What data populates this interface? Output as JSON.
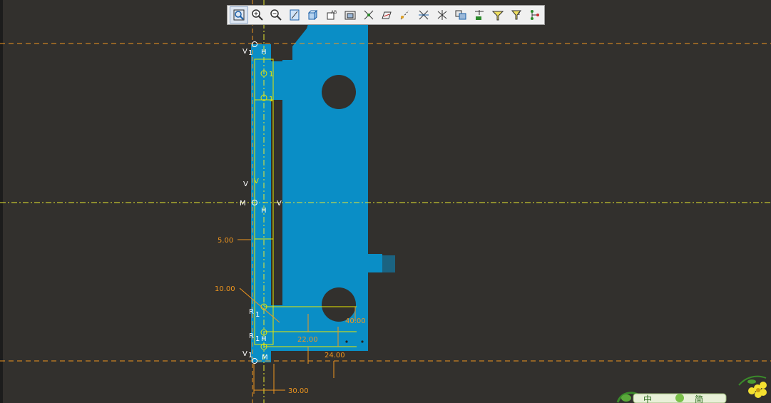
{
  "toolbar": {
    "buttons": [
      {
        "name": "fit-all-icon"
      },
      {
        "name": "zoom-in-icon"
      },
      {
        "name": "zoom-out-icon"
      },
      {
        "name": "normal-view-icon"
      },
      {
        "name": "view-mode-icon"
      },
      {
        "name": "render-style-icon"
      },
      {
        "name": "cut-part-icon"
      },
      {
        "name": "sketch-solving-status-icon"
      },
      {
        "name": "sketch-analysis-icon"
      },
      {
        "name": "construction-element-icon"
      },
      {
        "name": "geometric-constraints-icon"
      },
      {
        "name": "dimensional-constraints-icon"
      },
      {
        "name": "auto-constraint-icon"
      },
      {
        "name": "animate-constraint-icon"
      },
      {
        "name": "edit-multi-constraint-icon"
      },
      {
        "name": "show-hide-icon"
      },
      {
        "name": "connect-icon"
      }
    ]
  },
  "dimensions": {
    "d_5": "5.00",
    "d_10": "10.00",
    "d_40": "40.00",
    "d_22": "22.00",
    "d_24": "24.00",
    "d_30": "30.00"
  },
  "constraint_labels": {
    "v1_top": "V",
    "one_top": "1",
    "h_top": "H",
    "one_a": "1",
    "one_b": "1",
    "v_mid": "V",
    "m_mid": "M",
    "h_mid": "H",
    "v_right": "V",
    "r_1": "R",
    "one_c": "1",
    "r_2": "R",
    "one_d": "1",
    "h_low": "H",
    "v1_bot": "V",
    "one_bot": "1",
    "m_bot": "M"
  },
  "taskbar": {
    "ime_text": "中",
    "extra_text": "简"
  },
  "colors": {
    "background": "#32302d",
    "part": "#0a8ec6",
    "sketch": "#e8e800",
    "dimension": "#f0961e",
    "axis": "#e8e830"
  }
}
